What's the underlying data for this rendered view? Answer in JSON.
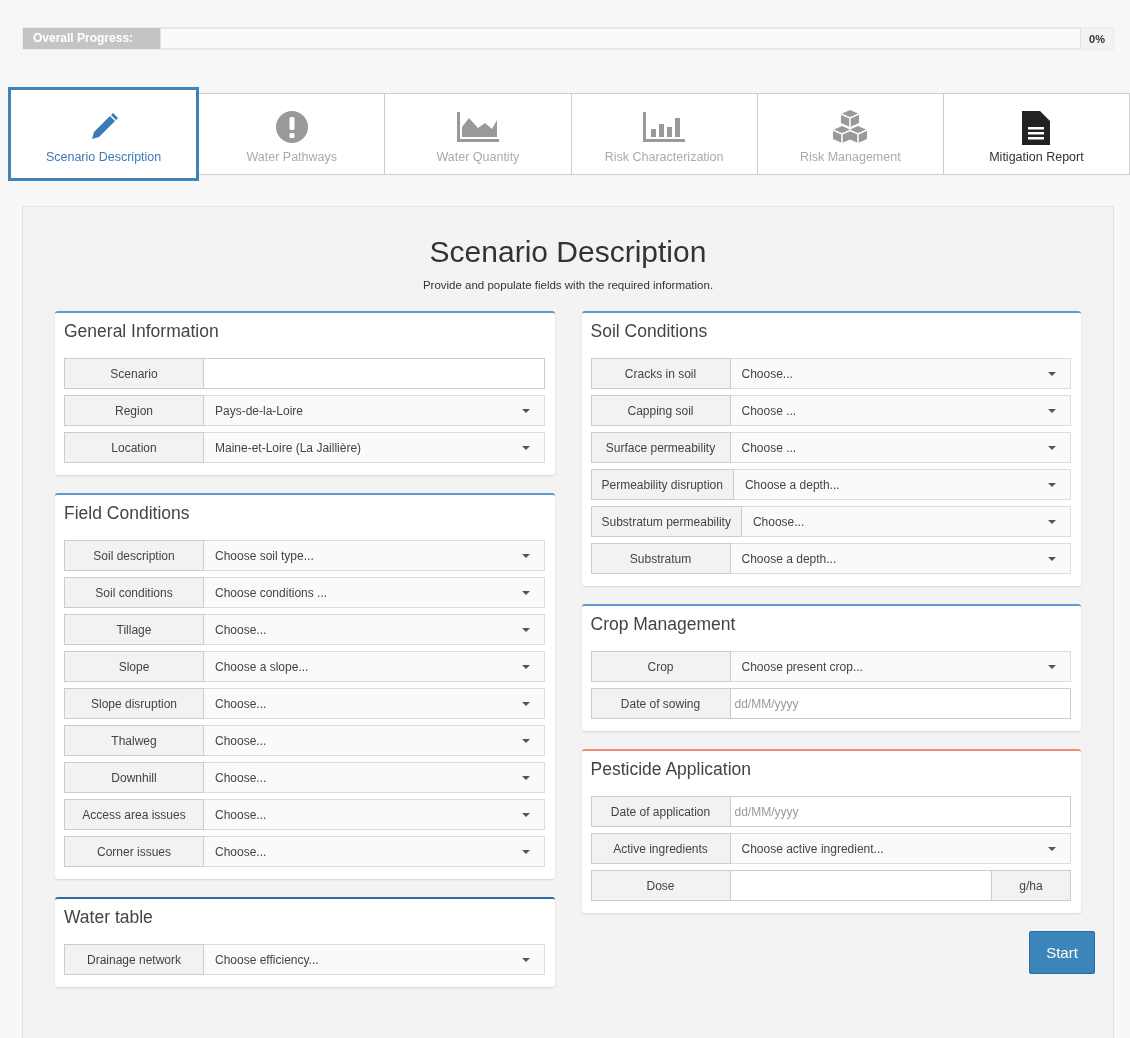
{
  "progress": {
    "label": "Overall Progress:",
    "level": 0,
    "reading": "0%"
  },
  "tabs": [
    {
      "label": "Scenario Description",
      "selected": true,
      "disabled": false
    },
    {
      "label": "Water Pathways",
      "selected": false,
      "disabled": true
    },
    {
      "label": "Water Quantity",
      "selected": false,
      "disabled": true
    },
    {
      "label": "Risk Characterization",
      "selected": false,
      "disabled": true
    },
    {
      "label": "Risk Management",
      "selected": false,
      "disabled": true
    },
    {
      "label": "Mitigation Report",
      "selected": false,
      "disabled": false
    }
  ],
  "page": {
    "title": "Scenario Description",
    "subtitle": "Provide and populate fields with the required information."
  },
  "columns": [
    [
      {
        "title": "General Information",
        "color": "#5b9bd5",
        "fields": [
          {
            "kind": "text",
            "label": "Scenario"
          },
          {
            "kind": "select",
            "label": "Region",
            "value": "Pays-de-la-Loire"
          },
          {
            "kind": "select",
            "label": "Location",
            "value": "Maine-et-Loire (La Jaillière)"
          }
        ]
      },
      {
        "title": "Field Conditions",
        "color": "#5b9bd5",
        "fields": [
          {
            "kind": "select",
            "label": "Soil description",
            "value": "Choose soil type..."
          },
          {
            "kind": "select",
            "label": "Soil conditions",
            "value": "Choose conditions ..."
          },
          {
            "kind": "select",
            "label": "Tillage",
            "value": "Choose..."
          },
          {
            "kind": "select",
            "label": "Slope",
            "value": "Choose a slope..."
          },
          {
            "kind": "select",
            "label": "Slope disruption",
            "value": "Choose..."
          },
          {
            "kind": "select",
            "label": "Thalweg",
            "value": "Choose..."
          },
          {
            "kind": "select",
            "label": "Downhill",
            "value": "Choose..."
          },
          {
            "kind": "select",
            "label": "Access area issues",
            "value": "Choose..."
          },
          {
            "kind": "select",
            "label": "Corner issues",
            "value": "Choose..."
          }
        ]
      },
      {
        "title": "Water table",
        "color": "#2e6da4",
        "fields": [
          {
            "kind": "select",
            "label": "Drainage network",
            "value": "Choose efficiency..."
          }
        ]
      }
    ],
    [
      {
        "title": "Soil Conditions",
        "color": "#5b9bd5",
        "fields": [
          {
            "kind": "select",
            "label": "Cracks in soil",
            "value": "Choose..."
          },
          {
            "kind": "select",
            "label": "Capping soil",
            "value": "Choose ..."
          },
          {
            "kind": "select",
            "label": "Surface permeability",
            "value": "Choose ..."
          },
          {
            "kind": "select",
            "label": "Permeability disruption",
            "value": "Choose a depth..."
          },
          {
            "kind": "select",
            "label": "Substratum permeability",
            "value": "Choose..."
          },
          {
            "kind": "select",
            "label": "Substratum",
            "value": "Choose a depth..."
          }
        ]
      },
      {
        "title": "Crop Management",
        "color": "#5b9bd5",
        "fields": [
          {
            "kind": "select",
            "label": "Crop",
            "value": "Choose present crop..."
          },
          {
            "kind": "date",
            "label": "Date of sowing",
            "placeholder": "dd/MM/yyyy"
          }
        ]
      },
      {
        "title": "Pesticide Application",
        "color": "#f08a7a",
        "fields": [
          {
            "kind": "date",
            "label": "Date of application",
            "placeholder": "dd/MM/yyyy"
          },
          {
            "kind": "select",
            "label": "Active ingredients",
            "value": "Choose active ingredient..."
          },
          {
            "kind": "unit",
            "label": "Dose",
            "unit": "g/ha"
          }
        ]
      }
    ]
  ],
  "start_button": "Start"
}
